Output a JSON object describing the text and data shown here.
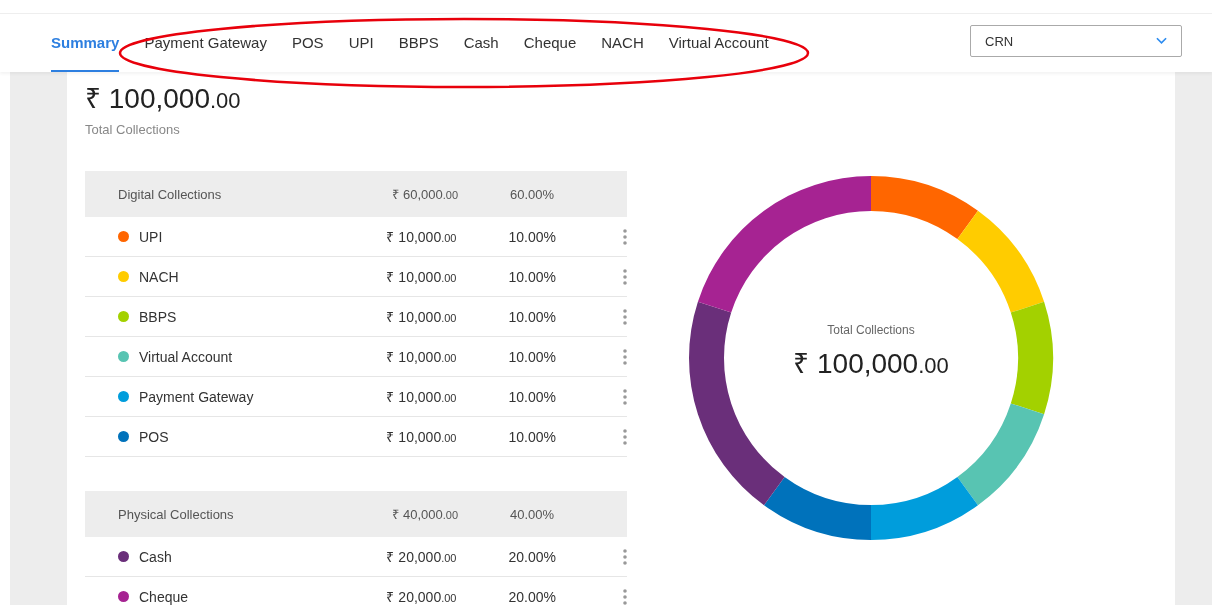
{
  "tabs": [
    {
      "label": "Summary",
      "selected": true
    },
    {
      "label": "Payment Gateway",
      "selected": false
    },
    {
      "label": "POS",
      "selected": false
    },
    {
      "label": "UPI",
      "selected": false
    },
    {
      "label": "BBPS",
      "selected": false
    },
    {
      "label": "Cash",
      "selected": false
    },
    {
      "label": "Cheque",
      "selected": false
    },
    {
      "label": "NACH",
      "selected": false
    },
    {
      "label": "Virtual Account",
      "selected": false
    }
  ],
  "annotation": {
    "kind": "ellipse",
    "color": "#e8000b"
  },
  "selector": {
    "value": "CRN"
  },
  "total": {
    "amount": "₹ 100,000",
    "decimals": ".00",
    "label": "Total Collections"
  },
  "groups": [
    {
      "title": "Digital Collections",
      "amount": "₹ 60,000",
      "decimals": ".00",
      "percent": "60.00%",
      "rows": [
        {
          "name": "UPI",
          "color": "#ff6600",
          "amount": "₹ 10,000",
          "decimals": ".00",
          "percent": "10.00%"
        },
        {
          "name": "NACH",
          "color": "#ffcc00",
          "amount": "₹ 10,000",
          "decimals": ".00",
          "percent": "10.00%"
        },
        {
          "name": "BBPS",
          "color": "#a3d100",
          "amount": "₹ 10,000",
          "decimals": ".00",
          "percent": "10.00%"
        },
        {
          "name": "Virtual Account",
          "color": "#58c4b2",
          "amount": "₹ 10,000",
          "decimals": ".00",
          "percent": "10.00%"
        },
        {
          "name": "Payment Gateway",
          "color": "#009ddc",
          "amount": "₹ 10,000",
          "decimals": ".00",
          "percent": "10.00%"
        },
        {
          "name": "POS",
          "color": "#0072bb",
          "amount": "₹ 10,000",
          "decimals": ".00",
          "percent": "10.00%"
        }
      ]
    },
    {
      "title": "Physical Collections",
      "amount": "₹ 40,000",
      "decimals": ".00",
      "percent": "40.00%",
      "rows": [
        {
          "name": "Cash",
          "color": "#6a2f7a",
          "amount": "₹ 20,000",
          "decimals": ".00",
          "percent": "20.00%"
        },
        {
          "name": "Cheque",
          "color": "#a62392",
          "amount": "₹ 20,000",
          "decimals": ".00",
          "percent": "20.00%"
        }
      ]
    }
  ],
  "donut": {
    "label": "Total Collections",
    "amount": "₹ 100,000",
    "decimals": ".00",
    "chart_data": {
      "type": "donut",
      "values": [
        10,
        10,
        10,
        10,
        10,
        10,
        20,
        20
      ],
      "colors": [
        "#ff6600",
        "#ffcc00",
        "#a3d100",
        "#58c4b2",
        "#009ddc",
        "#0072bb",
        "#6a2f7a",
        "#a62392"
      ]
    }
  }
}
